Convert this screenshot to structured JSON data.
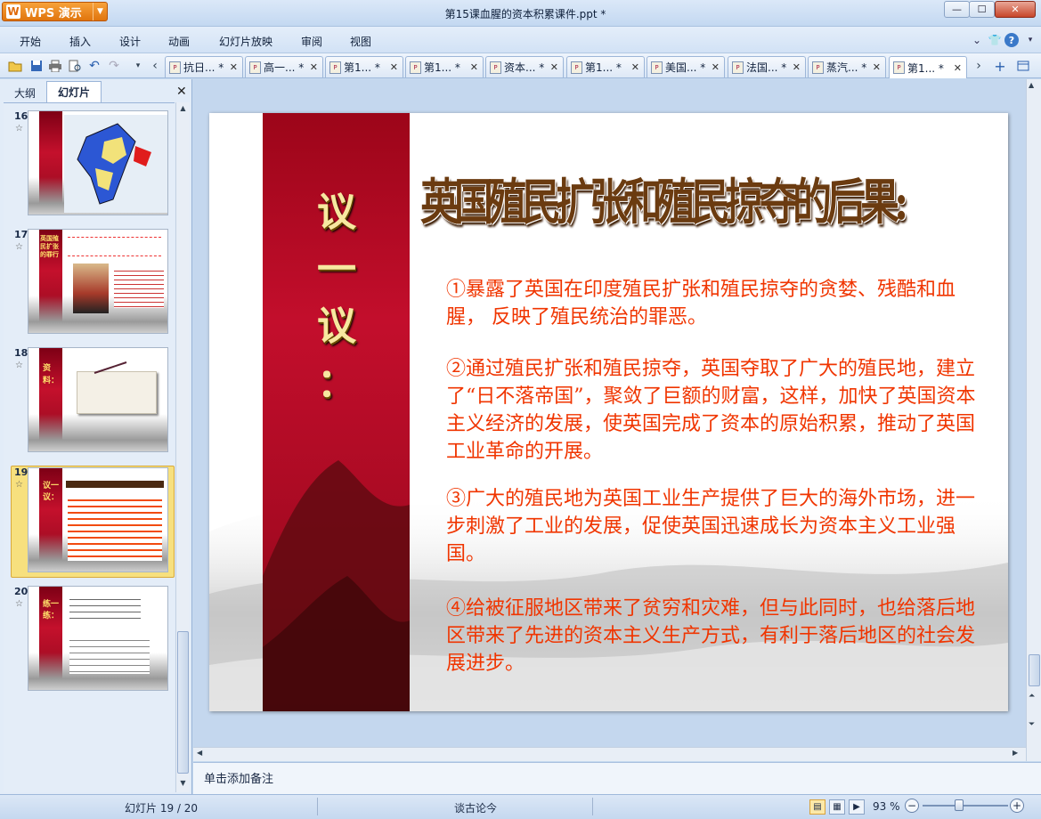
{
  "window": {
    "app_name": "WPS 演示",
    "title": "第15课血腥的资本积累课件.ppt *",
    "min_label": "—",
    "max_label": "☐",
    "close_label": "✕"
  },
  "menu": [
    "开始",
    "插入",
    "设计",
    "动画",
    "幻灯片放映",
    "审阅",
    "视图"
  ],
  "doc_tabs": [
    "抗日... *",
    "高一... *",
    "第1... *",
    "第1... *",
    "资本... *",
    "第1... *",
    "美国... *",
    "法国... *",
    "蒸汽... *",
    "第1... *"
  ],
  "active_tab_index": 9,
  "left_panel": {
    "tab_outline": "大纲",
    "tab_slides": "幻灯片",
    "close": "✕",
    "slides": [
      {
        "number": "16",
        "star": "☆"
      },
      {
        "number": "17",
        "star": "☆"
      },
      {
        "number": "18",
        "star": "☆"
      },
      {
        "number": "19",
        "star": "☆"
      },
      {
        "number": "20",
        "star": "☆"
      }
    ],
    "thumb17_band": "英国殖民扩张的罪行",
    "thumb18_band": "资料：",
    "thumb19_band": "议一议：",
    "thumb20_band": "练一练："
  },
  "slide": {
    "side_title": [
      "议",
      "一",
      "议",
      "："
    ],
    "heading": "英国殖民扩张和殖民掠夺的后果:",
    "paragraphs": [
      "①暴露了英国在印度殖民扩张和殖民掠夺的贪婪、残酷和血腥， 反映了殖民统治的罪恶。",
      "②通过殖民扩张和殖民掠夺，英国夺取了广大的殖民地，建立了“日不落帝国”，聚敛了巨额的财富，这样，加快了英国资本主义经济的发展，使英国完成了资本的原始积累，推动了英国工业革命的开展。",
      "③广大的殖民地为英国工业生产提供了巨大的海外市场，进一步刺激了工业的发展，促使英国迅速成长为资本主义工业强国。",
      "④给被征服地区带来了贫穷和灾难，但与此同时，也给落后地区带来了先进的资本主义生产方式，有利于落后地区的社会发展进步。"
    ]
  },
  "notes_placeholder": "单击添加备注",
  "status": {
    "slide_counter": "幻灯片 19 / 20",
    "theme": "谈古论今",
    "zoom": "93 %"
  },
  "colors": {
    "accent_red": "#c30e2c",
    "body_text": "#f03500",
    "heading_brown": "#6b3b10"
  }
}
